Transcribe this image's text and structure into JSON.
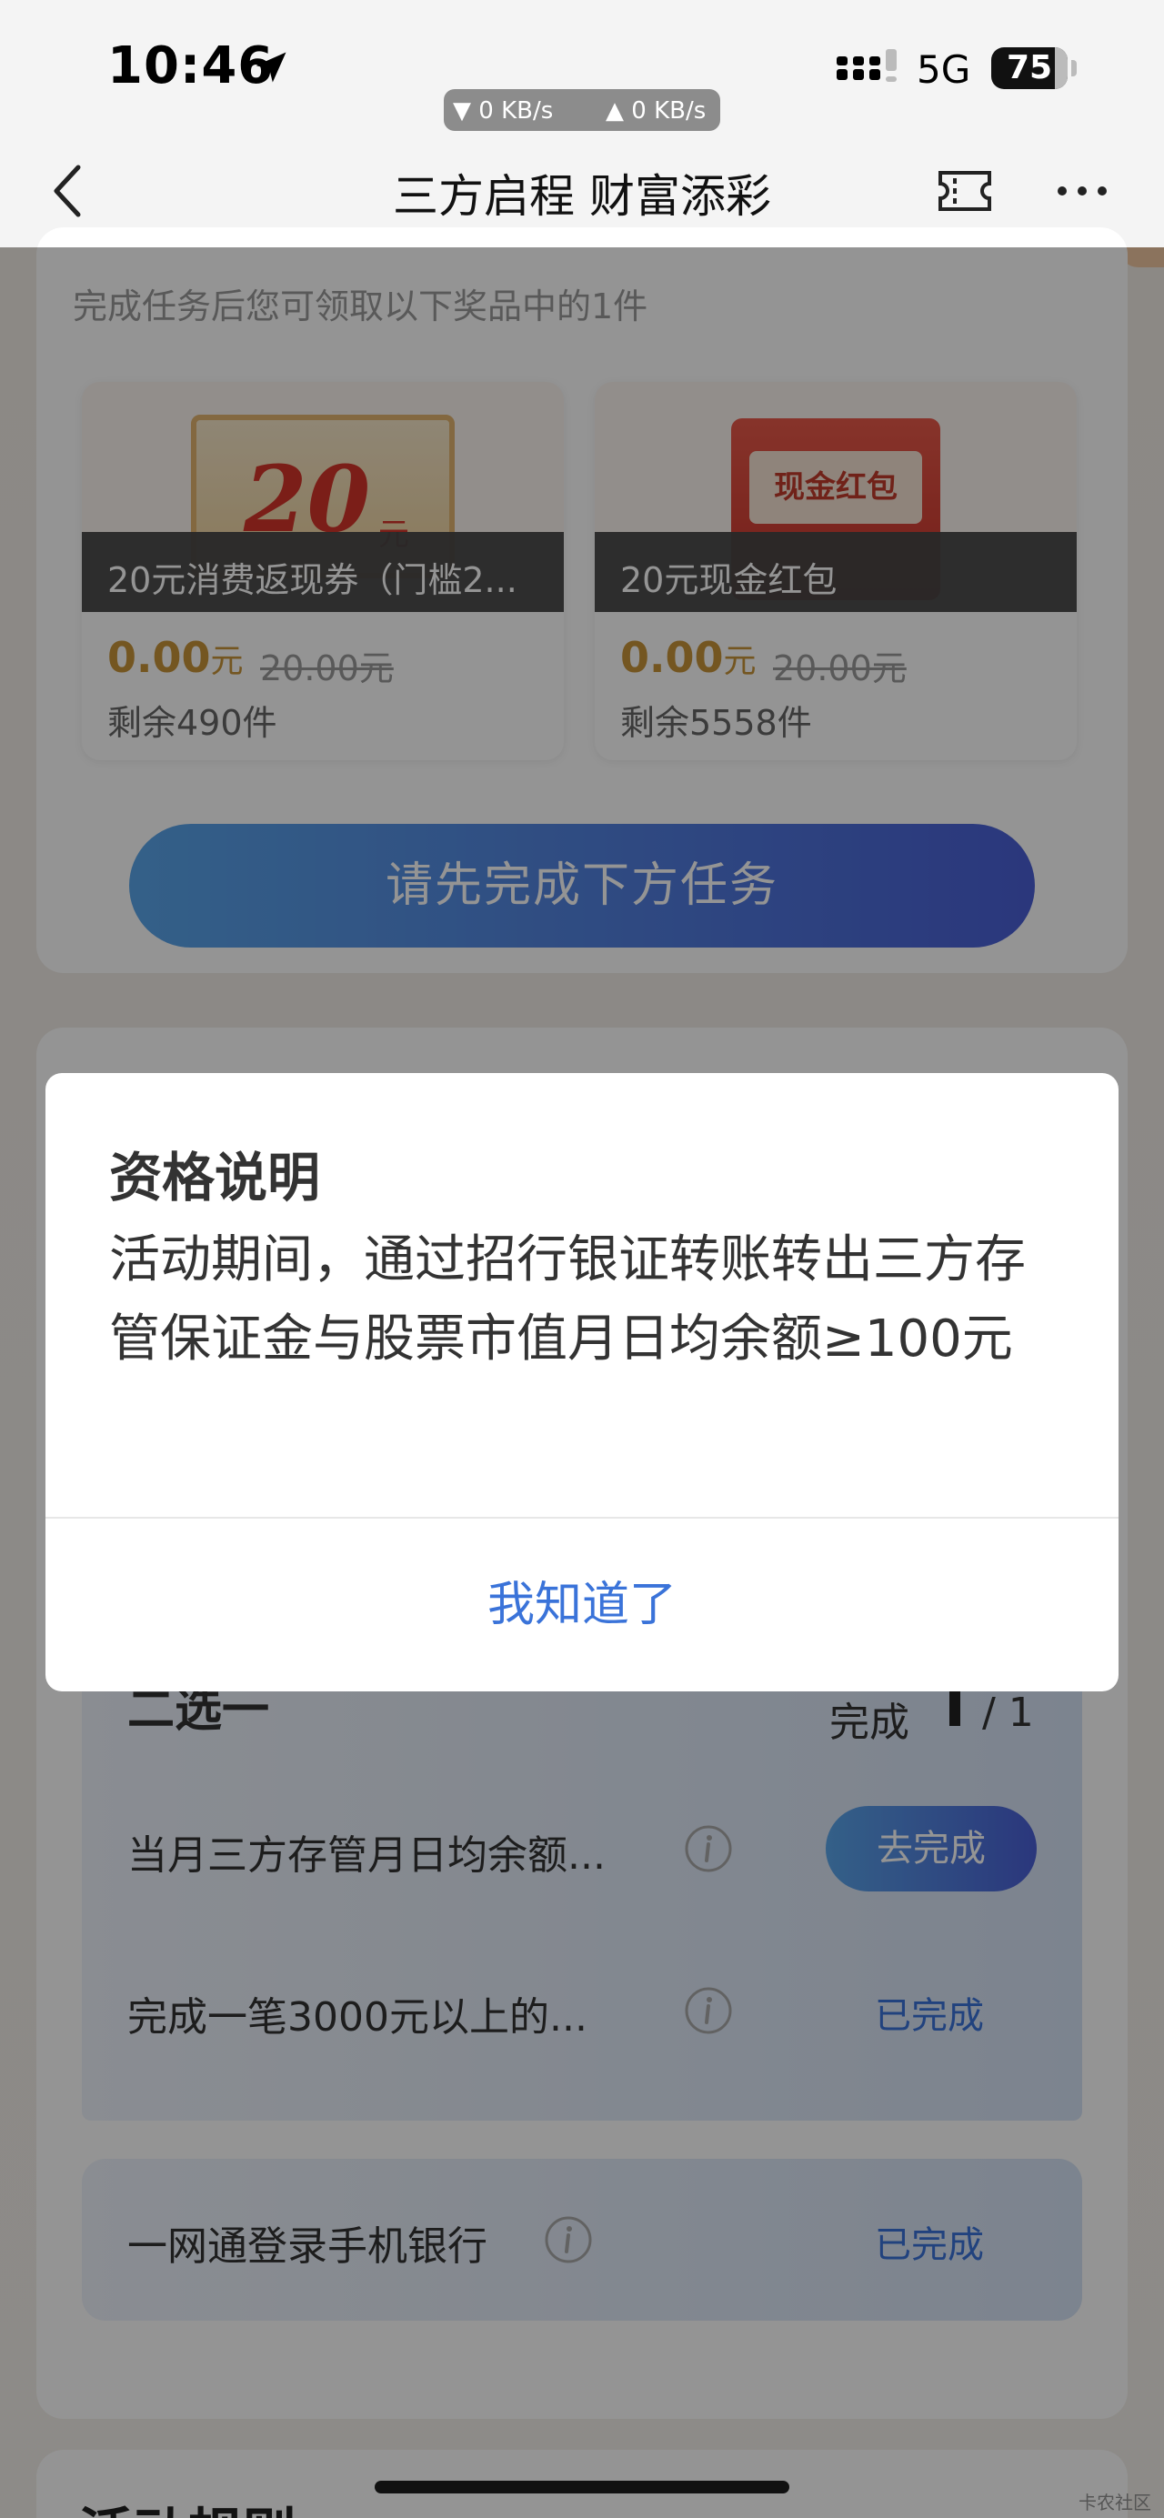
{
  "status_bar": {
    "time": "10:46",
    "download_speed": "▼ 0 KB/s",
    "upload_speed": "▲ 0 KB/s",
    "network": "5G",
    "battery": "75"
  },
  "nav": {
    "title": "三方启程 财富添彩"
  },
  "rewards": {
    "subtitle": "完成任务后您可领取以下奖品中的1件",
    "items": [
      {
        "image_text": "20",
        "image_unit": "元",
        "name": "20元消费返现券（门槛2...",
        "price": "0.00",
        "price_unit": "元",
        "original_price": "20.00元",
        "stock": "剩余490件"
      },
      {
        "image_text": "现金红包",
        "name": "20元现金红包",
        "price": "0.00",
        "price_unit": "元",
        "original_price": "20.00元",
        "stock": "剩余5558件"
      }
    ],
    "cta": "请先完成下方任务"
  },
  "tasks": {
    "group_title": "二选一",
    "progress_label": "完成",
    "progress_total": "/ 1",
    "rows": [
      {
        "text": "当月三方存管月日均余额...",
        "action": "去完成"
      },
      {
        "text": "完成一笔3000元以上的...",
        "action": "已完成"
      }
    ],
    "login_task": {
      "text": "一网通登录手机银行",
      "action": "已完成"
    }
  },
  "section3": {
    "title": "活动规则"
  },
  "modal": {
    "title": "资格说明",
    "body": "活动期间，通过招行银证转账转出三方存管保证金与股票市值月日均余额≥100元",
    "button": "我知道了"
  },
  "watermark": "卡农社区",
  "colors": {
    "accent_blue": "#3a73d9",
    "gradient_start": "#5aa6ea",
    "gradient_end": "#4a5fd6",
    "price_gold": "#c8953a"
  }
}
